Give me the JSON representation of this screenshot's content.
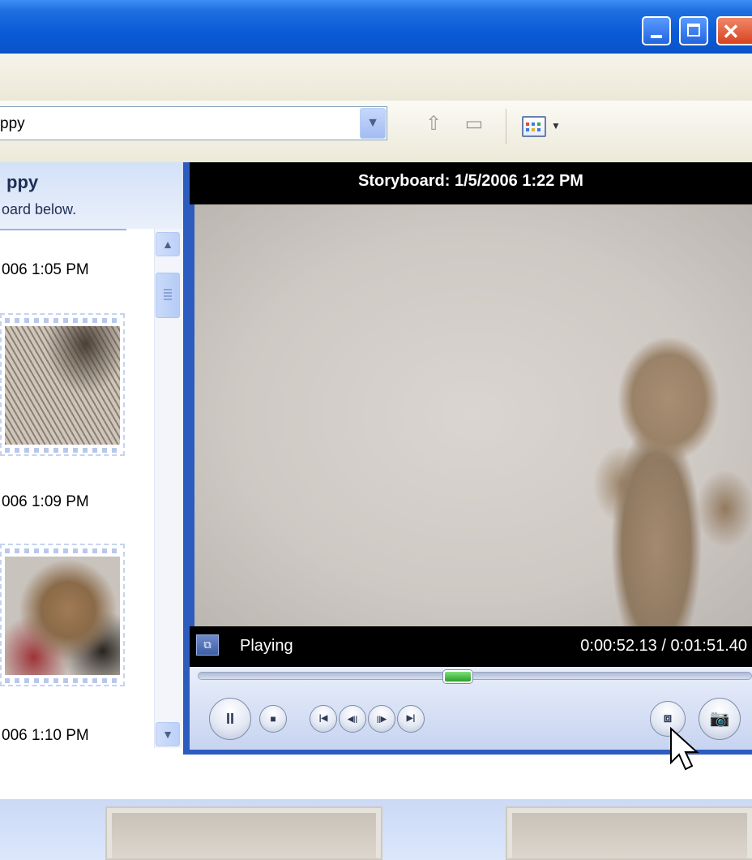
{
  "window": {
    "minimize_icon": "minimize-icon",
    "maximize_icon": "maximize-icon",
    "close_icon": "close-icon"
  },
  "toolbar": {
    "collection_value": "ppy",
    "dropdown_icon": "chevron-down-icon",
    "up_icon": "folder-up-icon",
    "new_folder_icon": "new-folder-icon",
    "views_icon": "views-icon"
  },
  "left_panel": {
    "title": "ppy",
    "subtitle": "oard below.",
    "clips": [
      {
        "time": "006 1:05 PM"
      },
      {
        "time": "006 1:09 PM"
      },
      {
        "time": "006 1:10 PM"
      }
    ]
  },
  "player": {
    "title": "Storyboard: 1/5/2006 1:22 PM",
    "status": "Playing",
    "time": "0:00:52.13 / 0:01:51.40",
    "progress": 0.468,
    "buttons": {
      "pause": "II",
      "stop": "■",
      "prev": "|◀",
      "back": "◀||",
      "forward": "||▶",
      "next": "▶|"
    }
  }
}
